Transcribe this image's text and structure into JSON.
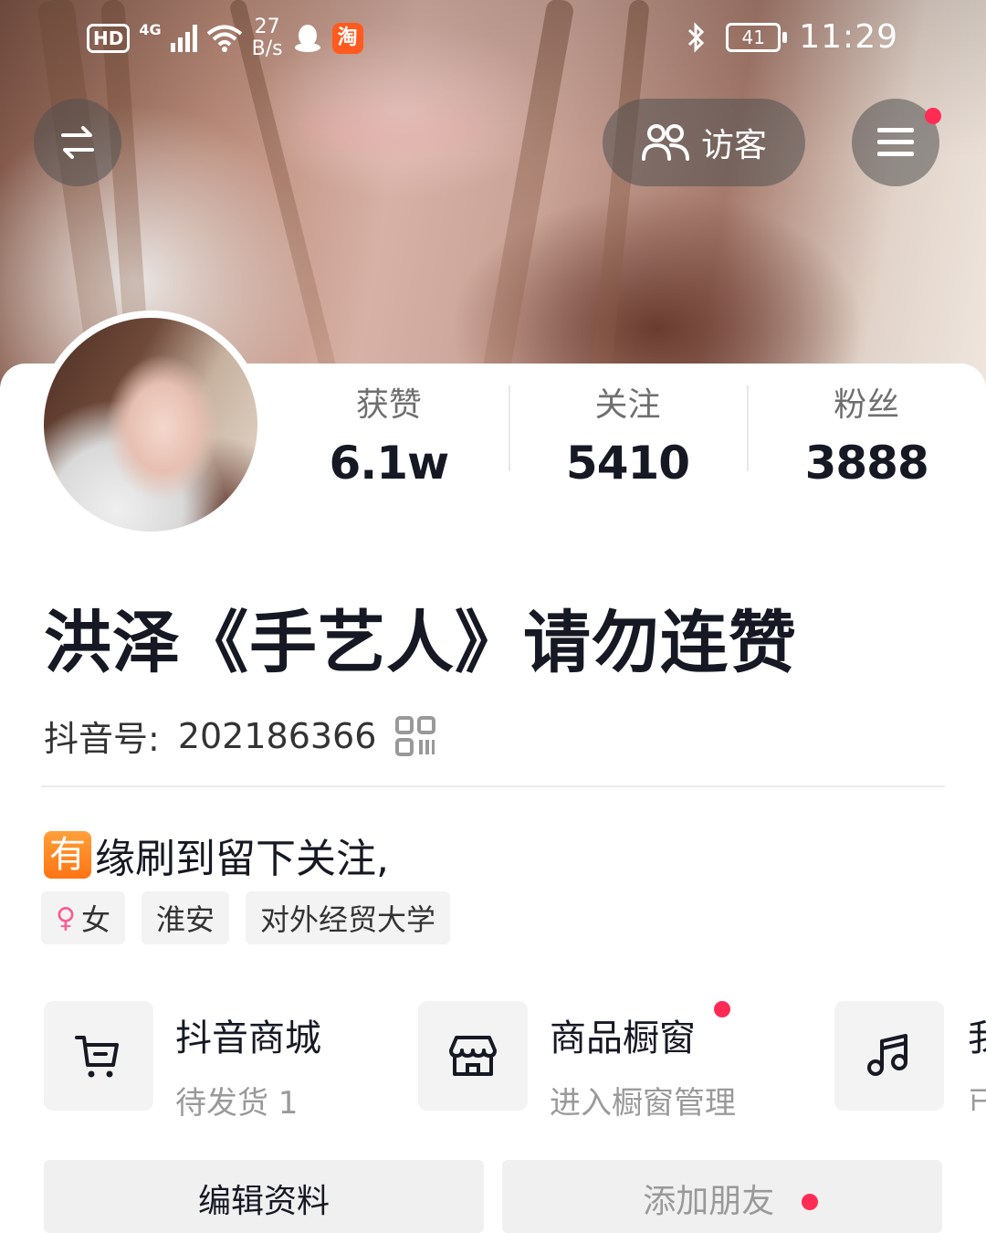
{
  "status_bar": {
    "hd": "HD",
    "network": "4G",
    "speed_value": "27",
    "speed_unit": "B/s",
    "battery": "41",
    "time": "11:29"
  },
  "header": {
    "visitors_label": "访客"
  },
  "stats": [
    {
      "label": "获赞",
      "value": "6.1w"
    },
    {
      "label": "关注",
      "value": "5410"
    },
    {
      "label": "粉丝",
      "value": "3888"
    }
  ],
  "profile": {
    "nickname": "洪泽《手艺人》请勿连赞",
    "douyin_id_label": "抖音号:",
    "douyin_id": "202186366",
    "bio_emoji": "有",
    "bio_text": "缘刷到留下关注,",
    "tags": {
      "gender": "女",
      "location": "淮安",
      "school": "对外经贸大学"
    }
  },
  "services": {
    "shop": {
      "title": "抖音商城",
      "subtitle": "待发货 1"
    },
    "window": {
      "title": "商品橱窗",
      "subtitle": "进入橱窗管理"
    },
    "music": {
      "title": "我",
      "subtitle": "已"
    }
  },
  "actions": {
    "edit": "编辑资料",
    "add_friend": "添加朋友"
  },
  "colors": {
    "accent_red": "#fe2c55",
    "female_pink": "#fc5a8f"
  }
}
